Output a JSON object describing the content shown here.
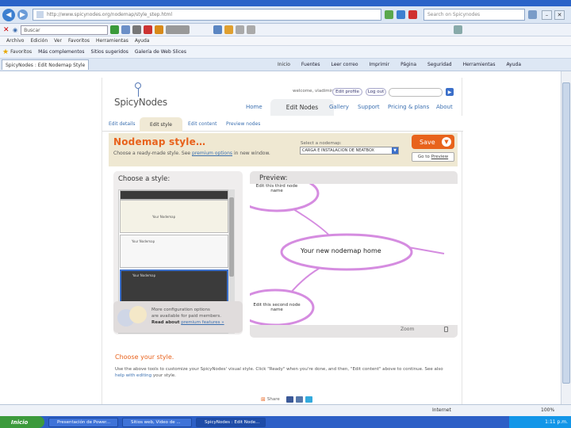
{
  "browser": {
    "url": "http://www.spicynodes.org/nodemap/style_step.html",
    "search_placeholder": "Search on Spicynodes",
    "toolbar_search_value": "Buscar",
    "menu": [
      "Archivo",
      "Edición",
      "Ver",
      "Favoritos",
      "Herramientas",
      "Ayuda"
    ],
    "favorites_label": "Favoritos",
    "favorites_items": [
      "Más complementos",
      "Sitios sugeridos",
      "Galería de Web Slices"
    ],
    "tab_title": "SpicyNodes : Edit Nodemap Style",
    "commands": [
      "Inicio",
      "Fuentes",
      "Leer correo",
      "Imprimir",
      "Página",
      "Seguridad",
      "Herramientas",
      "Ayuda"
    ]
  },
  "site": {
    "logo": "SpicyNodes",
    "welcome": "welcome, vladimir",
    "edit_profile": "Edit profile",
    "logout": "Log out",
    "main_nav": [
      "Home",
      "Edit Nodes",
      "Gallery",
      "Support",
      "Pricing & plans",
      "About"
    ],
    "active_main": "Edit Nodes",
    "sub_nav": [
      "Edit details",
      "Edit style",
      "Edit content",
      "Preview nodes"
    ],
    "active_sub": "Edit style"
  },
  "style_header": {
    "title": "Nodemap style…",
    "subtitle_pre": "Choose a ready-made style. See",
    "subtitle_link": "premium options",
    "subtitle_post": "in new window.",
    "select_label": "Select a nodemap:",
    "select_value": "CARGA E INSTALACION DE NEATBOX",
    "save_label": "Save",
    "goto_label": "Go to",
    "goto_link": "Preview"
  },
  "choose_panel": {
    "title": "Choose a style:",
    "thumb_labels": [
      "Your Nodemap",
      "Your Nodemap",
      "Your Nodemap"
    ]
  },
  "premium": {
    "line1": "More configuration options",
    "line2": "are available for paid members.",
    "line3_pre": "Read about",
    "line3_link": "premium features »"
  },
  "preview": {
    "title": "Preview:",
    "node_third": "Edit this third node name",
    "node_root": "Your new nodemap home",
    "node_second": "Edit this second node name",
    "zoom_label": "Zoom"
  },
  "bottom": {
    "title": "Choose your style.",
    "text_pre": "Use the above tools to customize your SpicyNodes' visual style. Click \"Ready\" when you're done, and then, \"Edit content\" above to continue. See also",
    "text_link": "help with editing",
    "text_post": "your style."
  },
  "share": {
    "label": "Share"
  },
  "status": {
    "zone": "Internet",
    "zoom": "100%"
  },
  "taskbar": {
    "start": "Inicio",
    "tasks": [
      "Presentación de Power...",
      "Sitios web, Video de ...",
      "SpicyNodes : Edit Node..."
    ],
    "clock": "1:11 p.m."
  },
  "colors": {
    "accent_orange": "#e8621c",
    "link_blue": "#3a6fb0",
    "header_beige": "#efe8d2",
    "node_pink": "#d58ce0"
  }
}
